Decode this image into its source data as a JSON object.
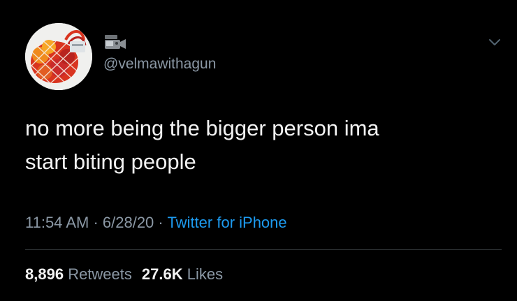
{
  "tweet": {
    "handle": "@velmawithagun",
    "text_line1": "no more being the bigger person ima",
    "text_line2": "start biting people",
    "time": "11:54 AM",
    "date": "6/28/20",
    "separator": " · ",
    "source": "Twitter for iPhone",
    "retweets_count": "8,896",
    "retweets_label": "Retweets",
    "likes_count": "27.6K",
    "likes_label": "Likes"
  },
  "colors": {
    "background": "#000000",
    "text": "#f2f2f2",
    "secondary": "#8b98a5",
    "link": "#1d9bf0"
  },
  "icons": {
    "display_name": "dvd-camera-emoji",
    "menu": "chevron-down-icon",
    "avatar": "fruit-net-bag-image"
  }
}
